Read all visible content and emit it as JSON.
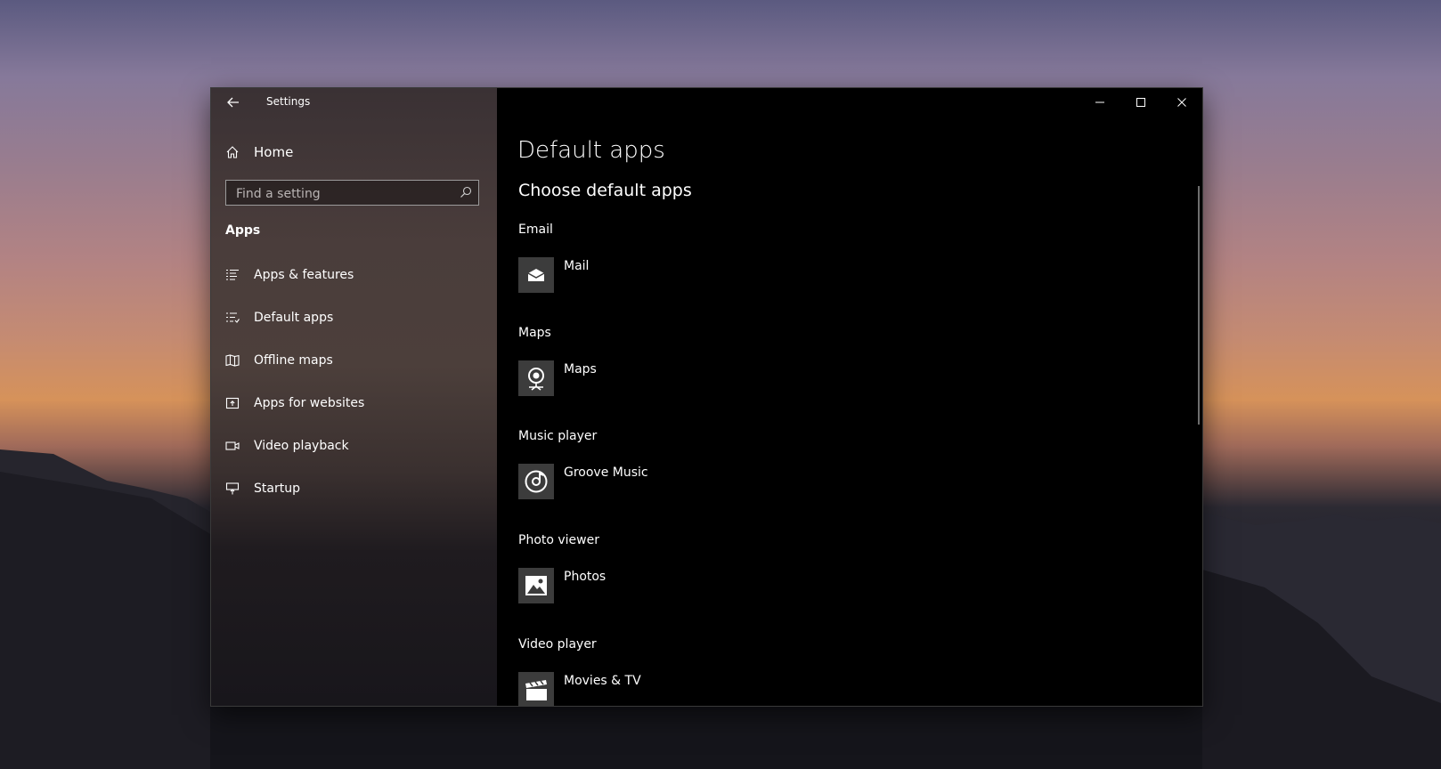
{
  "window": {
    "title": "Settings"
  },
  "sidebar": {
    "home_label": "Home",
    "search_placeholder": "Find a setting",
    "section": "Apps",
    "items": [
      {
        "label": "Apps & features",
        "icon": "list-icon"
      },
      {
        "label": "Default apps",
        "icon": "default-apps-icon"
      },
      {
        "label": "Offline maps",
        "icon": "map-icon"
      },
      {
        "label": "Apps for websites",
        "icon": "open-in-window-icon"
      },
      {
        "label": "Video playback",
        "icon": "video-icon"
      },
      {
        "label": "Startup",
        "icon": "startup-icon"
      }
    ]
  },
  "main": {
    "title": "Default apps",
    "subtitle": "Choose default apps",
    "groups": [
      {
        "label": "Email",
        "app": "Mail",
        "icon": "mail-icon"
      },
      {
        "label": "Maps",
        "app": "Maps",
        "icon": "maps-icon"
      },
      {
        "label": "Music player",
        "app": "Groove Music",
        "icon": "music-icon"
      },
      {
        "label": "Photo viewer",
        "app": "Photos",
        "icon": "photos-icon"
      },
      {
        "label": "Video player",
        "app": "Movies & TV",
        "icon": "movies-icon"
      }
    ]
  },
  "colors": {
    "window_background": "#000000",
    "app_tile": "#3c3c3c",
    "text": "#ffffff"
  }
}
